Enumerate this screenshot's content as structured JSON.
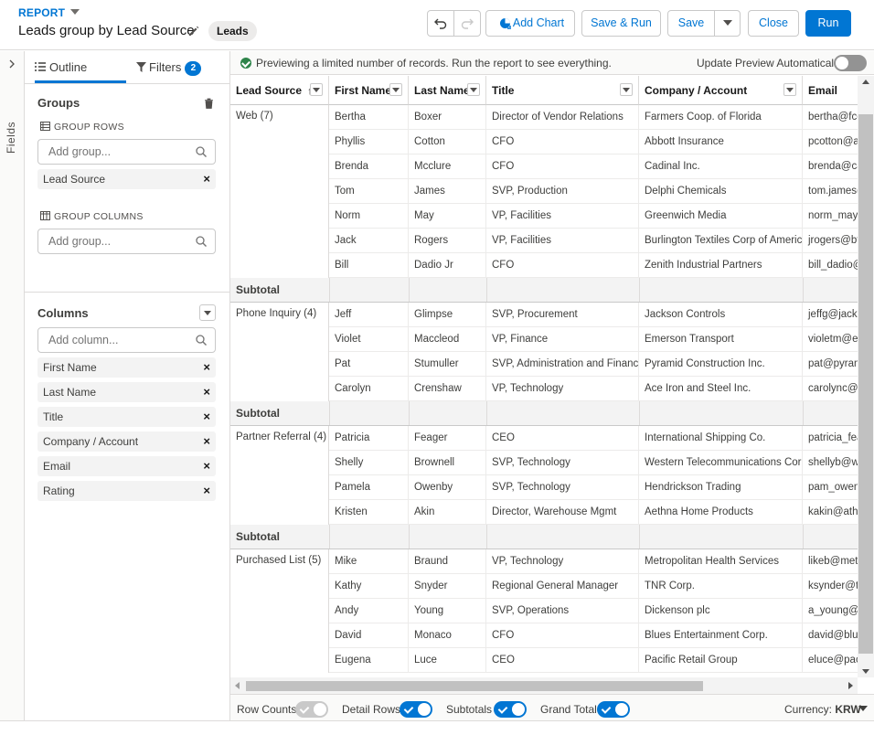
{
  "header": {
    "eyebrow": "REPORT",
    "title": "Leads group by Lead Source",
    "type_pill": "Leads",
    "buttons": {
      "add_chart": "Add Chart",
      "save_run": "Save & Run",
      "save": "Save",
      "close": "Close",
      "run": "Run"
    }
  },
  "left_rail": {
    "label": "Fields"
  },
  "sidebar": {
    "tabs": {
      "outline": "Outline",
      "filters": "Filters",
      "filters_count": "2"
    },
    "groups": {
      "title": "Groups",
      "group_rows_label": "GROUP ROWS",
      "group_rows_placeholder": "Add group...",
      "group_rows": [
        "Lead Source"
      ],
      "group_columns_label": "GROUP COLUMNS",
      "group_columns_placeholder": "Add group..."
    },
    "columns": {
      "title": "Columns",
      "placeholder": "Add column...",
      "items": [
        "First Name",
        "Last Name",
        "Title",
        "Company / Account",
        "Email",
        "Rating"
      ]
    }
  },
  "notice": {
    "message": "Previewing a limited number of records. Run the report to see everything.",
    "update_label": "Update Preview Automatically",
    "update_on": false
  },
  "table": {
    "headers": [
      "Lead Source",
      "First Name",
      "Last Name",
      "Title",
      "Company / Account",
      "Email"
    ],
    "subtotal_label": "Subtotal",
    "groups": [
      {
        "label": "Web (7)",
        "rows": [
          [
            "Bertha",
            "Boxer",
            "Director of Vendor Relations",
            "Farmers Coop. of Florida",
            "bertha@fcc"
          ],
          [
            "Phyllis",
            "Cotton",
            "CFO",
            "Abbott Insurance",
            "pcotton@a"
          ],
          [
            "Brenda",
            "Mcclure",
            "CFO",
            "Cadinal Inc.",
            "brenda@ca"
          ],
          [
            "Tom",
            "James",
            "SVP, Production",
            "Delphi Chemicals",
            "tom.james("
          ],
          [
            "Norm",
            "May",
            "VP, Facilities",
            "Greenwich Media",
            "norm_may("
          ],
          [
            "Jack",
            "Rogers",
            "VP, Facilities",
            "Burlington Textiles Corp of America",
            "jrogers@bt"
          ],
          [
            "Bill",
            "Dadio Jr",
            "CFO",
            "Zenith Industrial Partners",
            "bill_dadio@"
          ]
        ]
      },
      {
        "label": "Phone Inquiry (4)",
        "rows": [
          [
            "Jeff",
            "Glimpse",
            "SVP, Procurement",
            "Jackson Controls",
            "jeffg@jacks"
          ],
          [
            "Violet",
            "Maccleod",
            "VP, Finance",
            "Emerson Transport",
            "violetm@er"
          ],
          [
            "Pat",
            "Stumuller",
            "SVP, Administration and Finance",
            "Pyramid Construction Inc.",
            "pat@pyram"
          ],
          [
            "Carolyn",
            "Crenshaw",
            "VP, Technology",
            "Ace Iron and Steel Inc.",
            "carolync@a"
          ]
        ]
      },
      {
        "label": "Partner Referral (4)",
        "rows": [
          [
            "Patricia",
            "Feager",
            "CEO",
            "International Shipping Co.",
            "patricia_fea"
          ],
          [
            "Shelly",
            "Brownell",
            "SVP, Technology",
            "Western Telecommunications Corp.",
            "shellyb@we"
          ],
          [
            "Pamela",
            "Owenby",
            "SVP, Technology",
            "Hendrickson Trading",
            "pam_owent"
          ],
          [
            "Kristen",
            "Akin",
            "Director, Warehouse Mgmt",
            "Aethna Home Products",
            "kakin@athe"
          ]
        ]
      },
      {
        "label": "Purchased List (5)",
        "rows": [
          [
            "Mike",
            "Braund",
            "VP, Technology",
            "Metropolitan Health Services",
            "likeb@metr"
          ],
          [
            "Kathy",
            "Snyder",
            "Regional General Manager",
            "TNR Corp.",
            "ksynder@tr"
          ],
          [
            "Andy",
            "Young",
            "SVP, Operations",
            "Dickenson plc",
            "a_young@c"
          ],
          [
            "David",
            "Monaco",
            "CFO",
            "Blues Entertainment Corp.",
            "david@blue"
          ],
          [
            "Eugena",
            "Luce",
            "CEO",
            "Pacific Retail Group",
            "eluce@pac"
          ]
        ]
      }
    ]
  },
  "footer": {
    "row_counts": "Row Counts",
    "detail_rows": "Detail Rows",
    "subtotals": "Subtotals",
    "grand_total": "Grand Total",
    "currency_label": "Currency:",
    "currency_value": "KRW"
  }
}
